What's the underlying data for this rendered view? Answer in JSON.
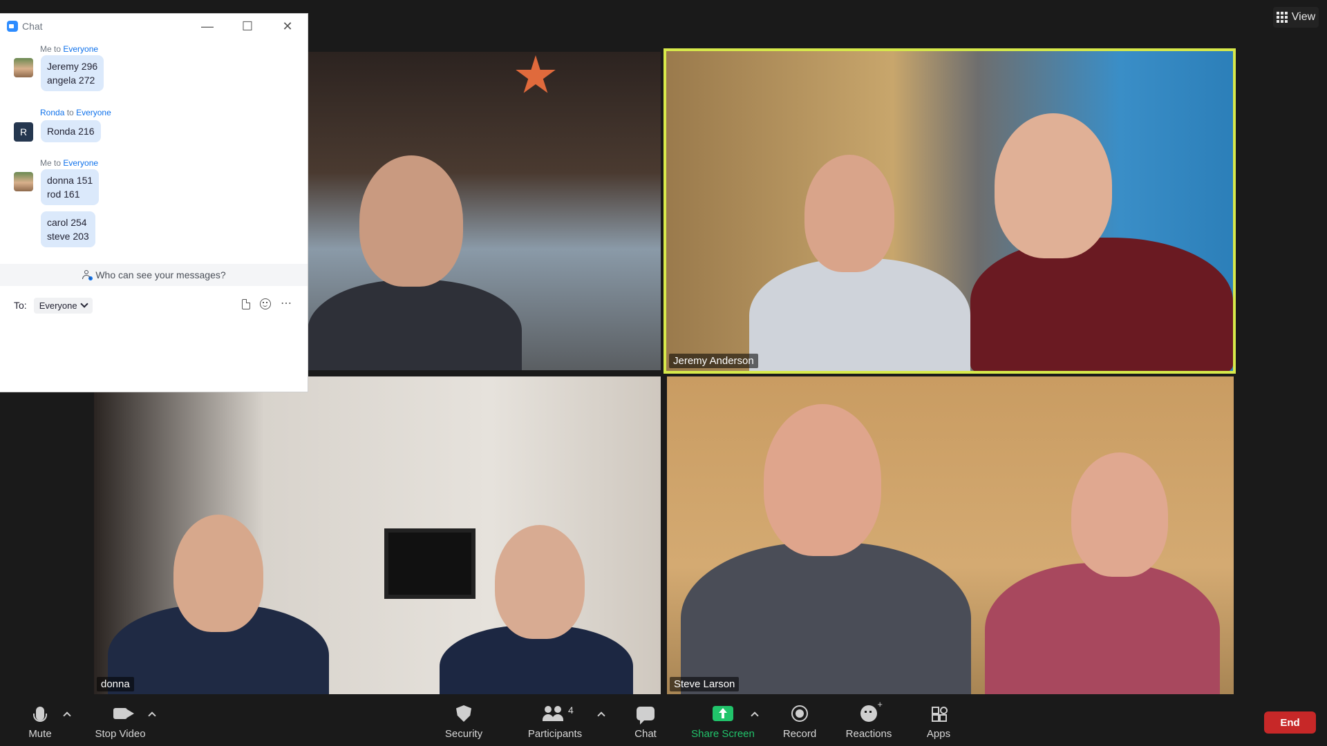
{
  "top_bar": {
    "view_label": "View"
  },
  "tiles": [
    {
      "name": ""
    },
    {
      "name": "Jeremy Anderson",
      "active_speaker": true,
      "highlight_color": "#d7e94a"
    },
    {
      "name": "donna"
    },
    {
      "name": "Steve Larson"
    }
  ],
  "chat": {
    "title": "Chat",
    "messages": [
      {
        "sender": "Me",
        "connector": "to",
        "recipient": "Everyone",
        "avatar": "photo",
        "bubbles": [
          [
            "Jeremy 296",
            "angela 272"
          ]
        ]
      },
      {
        "sender": "Ronda",
        "connector": "to",
        "recipient": "Everyone",
        "avatar": "R",
        "bubbles": [
          [
            "Ronda 216"
          ]
        ]
      },
      {
        "sender": "Me",
        "connector": "to",
        "recipient": "Everyone",
        "avatar": "photo",
        "bubbles": [
          [
            "donna 151",
            "rod 161"
          ],
          [
            "carol 254",
            "steve 203"
          ]
        ]
      }
    ],
    "visibility_text": "Who can see your messages?",
    "to_label": "To:",
    "to_value": "Everyone"
  },
  "toolbar": {
    "mute": "Mute",
    "stop_video": "Stop Video",
    "security": "Security",
    "participants": "Participants",
    "participants_count": "4",
    "chat": "Chat",
    "share_screen": "Share Screen",
    "record": "Record",
    "reactions": "Reactions",
    "apps": "Apps",
    "end": "End",
    "share_color": "#21c46b",
    "end_color": "#c72828"
  }
}
